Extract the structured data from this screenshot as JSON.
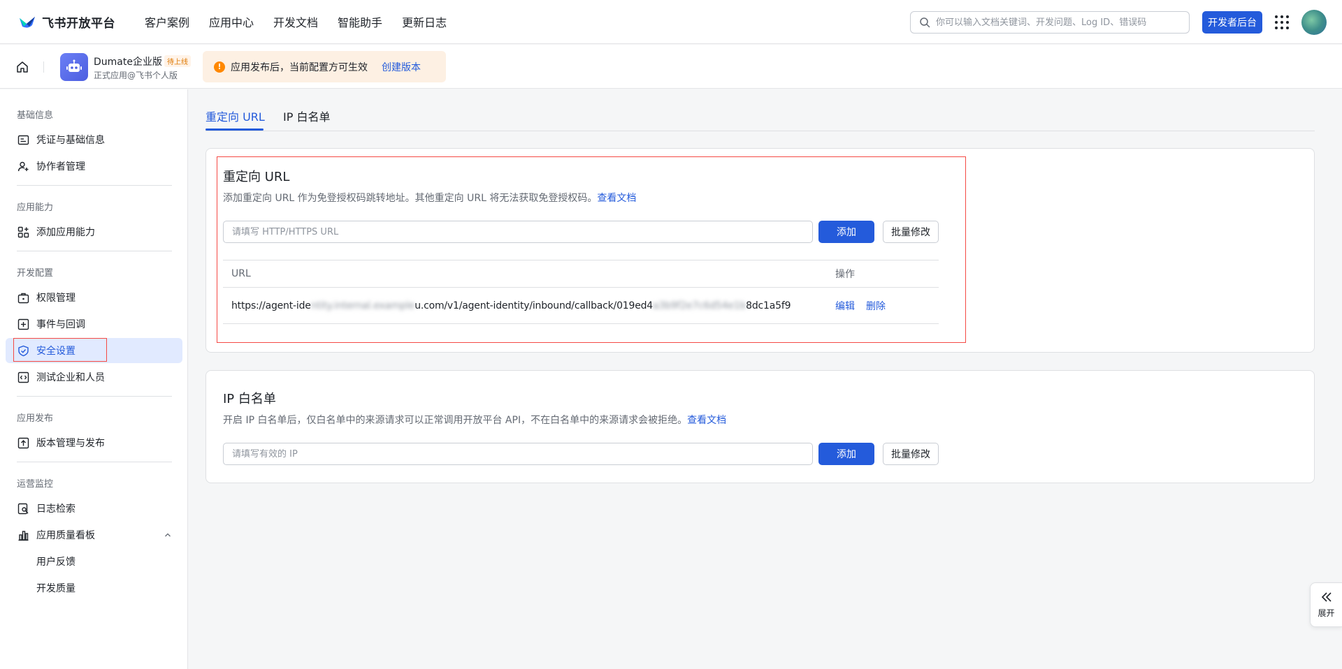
{
  "brand": {
    "name": "飞书开放平台"
  },
  "nav": {
    "items": [
      "客户案例",
      "应用中心",
      "开发文档",
      "智能助手",
      "更新日志"
    ]
  },
  "search": {
    "placeholder": "你可以输入文档关键词、开发问题、Log ID、错误码"
  },
  "header": {
    "dev_console_label": "开发者后台"
  },
  "app": {
    "name": "Dumate企业版",
    "status_badge": "待上线",
    "subtitle": "正式应用@飞书个人版"
  },
  "notice": {
    "text": "应用发布后，当前配置方可生效",
    "link": "创建版本"
  },
  "sidebar": {
    "groups": [
      {
        "title": "基础信息",
        "items": [
          "凭证与基础信息",
          "协作者管理"
        ]
      },
      {
        "title": "应用能力",
        "items": [
          "添加应用能力"
        ]
      },
      {
        "title": "开发配置",
        "items": [
          "权限管理",
          "事件与回调",
          "安全设置",
          "测试企业和人员"
        ]
      },
      {
        "title": "应用发布",
        "items": [
          "版本管理与发布"
        ]
      },
      {
        "title": "运营监控",
        "items": [
          "日志检索",
          "应用质量看板",
          "用户反馈",
          "开发质量"
        ]
      }
    ],
    "active_item": "安全设置"
  },
  "tabs": {
    "items": [
      "重定向 URL",
      "IP 白名单"
    ],
    "active": "重定向 URL"
  },
  "redirect_section": {
    "title": "重定向 URL",
    "description": "添加重定向 URL 作为免登授权码跳转地址。其他重定向 URL 将无法获取免登授权码。",
    "doc_link": "查看文档",
    "input_placeholder": "请填写 HTTP/HTTPS URL",
    "add_label": "添加",
    "batch_label": "批量修改",
    "table": {
      "columns": [
        "URL",
        "操作"
      ],
      "rows": [
        {
          "url_prefix": "https://agent-ide",
          "url_blur1": "ntity.internal.example",
          "url_middle": "u.com/v1/agent-identity/inbound/callback/019ed4",
          "url_blur2": "a3b9f2e7c6d54e1b",
          "url_suffix": "8dc1a5f9",
          "edit": "编辑",
          "delete": "删除"
        }
      ]
    }
  },
  "ip_section": {
    "title": "IP 白名单",
    "description": "开启 IP 白名单后，仅白名单中的来源请求可以正常调用开放平台 API，不在白名单中的来源请求会被拒绝。",
    "doc_link": "查看文档",
    "input_placeholder": "请填写有效的 IP",
    "add_label": "添加",
    "batch_label": "批量修改"
  },
  "expand": {
    "label": "展开"
  },
  "colors": {
    "accent": "#245bdb",
    "active_bg": "#e1eaff",
    "highlight": "#f54a45",
    "notice_bg": "#fdf0e3"
  }
}
